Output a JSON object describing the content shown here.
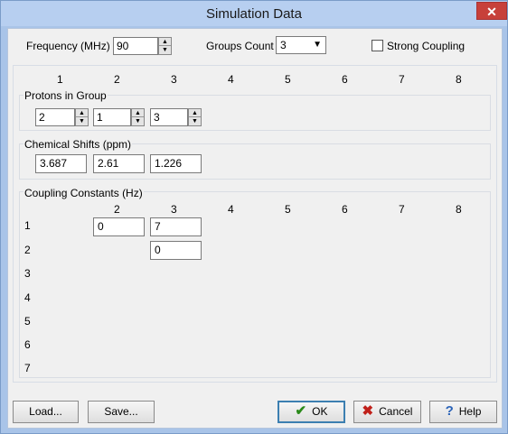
{
  "window": {
    "title": "Simulation Data",
    "close_glyph": "✕"
  },
  "frequency": {
    "label": "Frequency (MHz) :",
    "value": "90"
  },
  "groups_count": {
    "label": "Groups Count :",
    "value": "3"
  },
  "strong_coupling": {
    "label": "Strong Coupling",
    "checked": false
  },
  "column_numbers": [
    "1",
    "2",
    "3",
    "4",
    "5",
    "6",
    "7",
    "8"
  ],
  "protons": {
    "title": "Protons in Group",
    "values": [
      "2",
      "1",
      "3"
    ]
  },
  "shifts": {
    "title": "Chemical Shifts (ppm)",
    "values": [
      "3.687",
      "2.61",
      "1.226"
    ]
  },
  "coupling": {
    "title": "Coupling Constants (Hz)",
    "column_numbers": [
      "2",
      "3",
      "4",
      "5",
      "6",
      "7",
      "8"
    ],
    "row_numbers": [
      "1",
      "2",
      "3",
      "4",
      "5",
      "6",
      "7"
    ],
    "cells": {
      "r1c2": "0",
      "r1c3": "7",
      "r2c3": "0"
    }
  },
  "buttons": {
    "load": "Load...",
    "save": "Save...",
    "ok": "OK",
    "cancel": "Cancel",
    "help": "Help"
  },
  "icons": {
    "ok": "check-icon",
    "cancel": "cross-icon",
    "help": "question-icon",
    "ok_color": "#2a8a1a",
    "cancel_color": "#c0201a",
    "help_color": "#2a63b8"
  }
}
